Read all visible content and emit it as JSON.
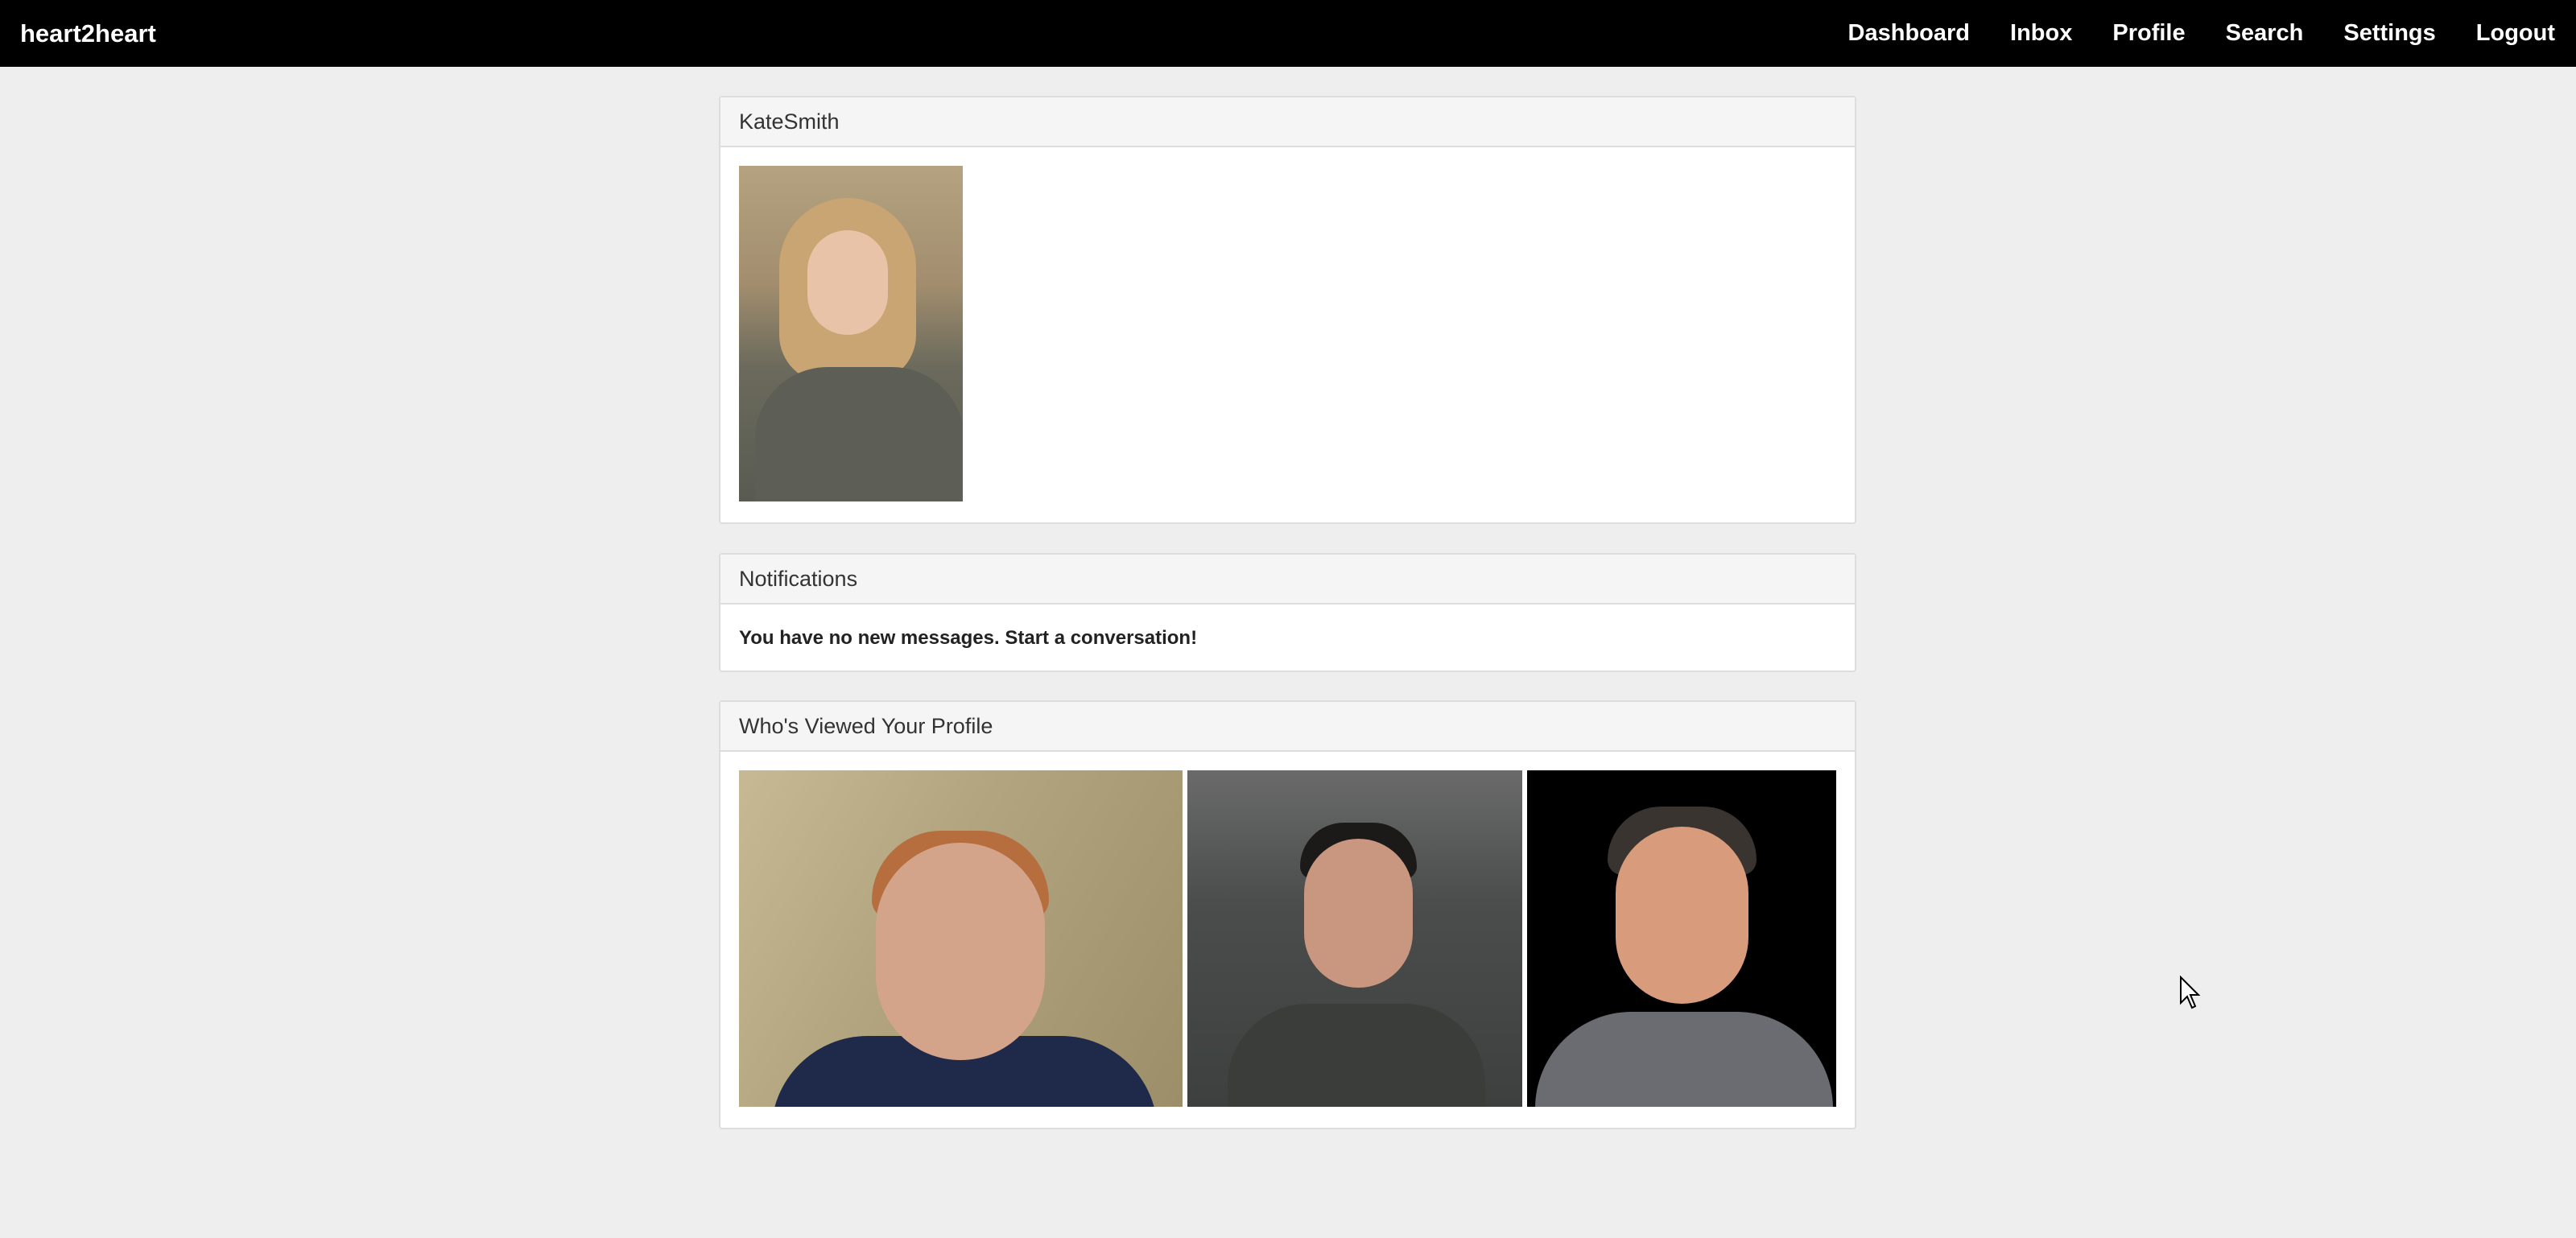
{
  "navbar": {
    "brand": "heart2heart",
    "links": [
      "Dashboard",
      "Inbox",
      "Profile",
      "Search",
      "Settings",
      "Logout"
    ]
  },
  "profile": {
    "username": "KateSmith"
  },
  "notifications": {
    "title": "Notifications",
    "message": "You have no new messages. Start a conversation!"
  },
  "viewers": {
    "title": "Who's Viewed Your Profile",
    "count": 3
  }
}
